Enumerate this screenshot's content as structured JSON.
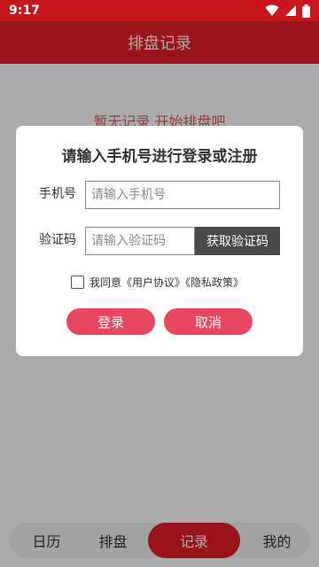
{
  "status_bar": {
    "time": "9:17"
  },
  "app_bar": {
    "title": "排盘记录"
  },
  "content": {
    "empty_message": "暂无记录,开始排盘吧"
  },
  "dialog": {
    "title": "请输入手机号进行登录或注册",
    "phone_label": "手机号",
    "phone_placeholder": "请输入手机号",
    "code_label": "验证码",
    "code_placeholder": "请输入验证码",
    "get_code_button": "获取验证码",
    "agree_text": "我同意《用户协议》《隐私政策》",
    "agree_checked": false,
    "login_button": "登录",
    "cancel_button": "取消"
  },
  "bottom_nav": {
    "items": [
      {
        "label": "日历",
        "active": false
      },
      {
        "label": "排盘",
        "active": false
      },
      {
        "label": "记录",
        "active": true
      },
      {
        "label": "我的",
        "active": false
      }
    ]
  },
  "colors": {
    "brand_red": "#e31e24",
    "status_red": "#c8161e",
    "button_pink": "#e8475f",
    "dark_button": "#4a4a4a"
  }
}
